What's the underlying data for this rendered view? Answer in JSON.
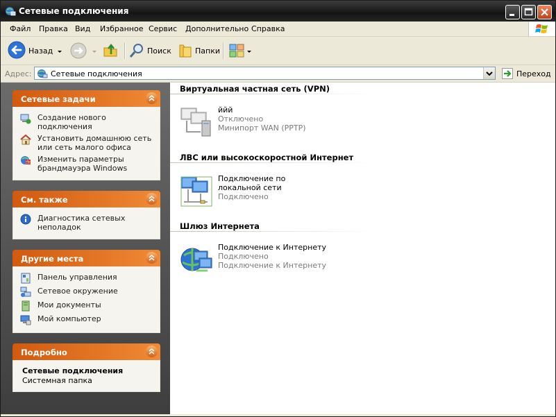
{
  "window": {
    "title": "Сетевые подключения"
  },
  "menu": {
    "items": [
      "Файл",
      "Правка",
      "Вид",
      "Избранное",
      "Сервис",
      "Дополнительно",
      "Справка"
    ]
  },
  "toolbar": {
    "back_label": "Назад",
    "search_label": "Поиск",
    "folders_label": "Папки"
  },
  "address": {
    "label": "Адрес:",
    "value": "Сетевые подключения",
    "go_label": "Переход"
  },
  "left_panels": {
    "tasks": {
      "title": "Сетевые задачи",
      "items": [
        {
          "label": "Создание нового подключения",
          "icon": "new-connection-icon"
        },
        {
          "label": "Установить домашнюю сеть или сеть малого офиса",
          "icon": "home-network-icon"
        },
        {
          "label": "Изменить параметры брандмауэра Windows",
          "icon": "firewall-icon"
        }
      ]
    },
    "see_also": {
      "title": "См. также",
      "items": [
        {
          "label": "Диагностика сетевых неполадок",
          "icon": "info-icon"
        }
      ]
    },
    "other_places": {
      "title": "Другие места",
      "items": [
        {
          "label": "Панель управления",
          "icon": "control-panel-icon"
        },
        {
          "label": "Сетевое окружение",
          "icon": "network-places-icon"
        },
        {
          "label": "Мои документы",
          "icon": "documents-icon"
        },
        {
          "label": "Мой компьютер",
          "icon": "computer-icon"
        }
      ]
    },
    "details": {
      "title": "Подробно",
      "name": "Сетевые подключения",
      "desc": "Системная папка"
    }
  },
  "groups": [
    {
      "title": "Виртуальная частная сеть (VPN)",
      "connections": [
        {
          "name": "ййй",
          "status": "Отключено",
          "device": "Минипорт WAN (PPTP)",
          "icon": "vpn-connection-icon"
        }
      ]
    },
    {
      "title": "ЛВС или высокоскоростной Интернет",
      "connections": [
        {
          "name": "Подключение по локальной сети",
          "status": "Подключено",
          "device": "",
          "icon": "lan-connection-icon"
        }
      ]
    },
    {
      "title": "Шлюз Интернета",
      "connections": [
        {
          "name": "Подключение к Интернету",
          "status": "Подключено",
          "device": "Подключение к Интернету",
          "icon": "internet-gateway-icon"
        }
      ]
    }
  ],
  "colors": {
    "panel_header": "#e0701e",
    "left_pane": "#555555",
    "title_bar": "#1e1e1e"
  }
}
